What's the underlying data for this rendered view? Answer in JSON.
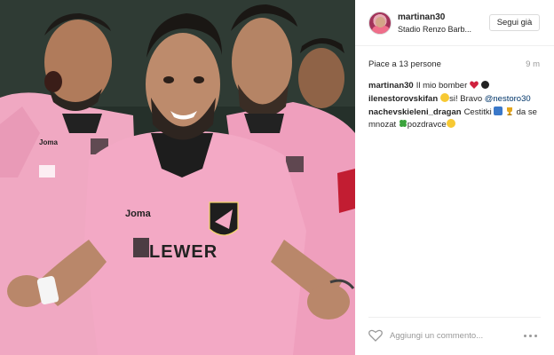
{
  "post": {
    "username": "martinan30",
    "location": "Stadio Renzo Barb...",
    "follow_label": "Segui già",
    "likes_text": "Piace a 13 persone",
    "time_ago": "9 m"
  },
  "photo": {
    "shirt_brand": "Joma",
    "sponsor": "LEWER",
    "alt_subject": "footballers in pink jerseys celebrating"
  },
  "comments": [
    {
      "user": "martinan30",
      "text": "Il mio bomber",
      "emoji": [
        "heart-icon",
        "black-circle-icon"
      ]
    },
    {
      "user": "ilenestorovskifan",
      "text_before": "",
      "text": "si! Bravo",
      "mention": "@nestoro30",
      "emoji": [
        "smiley-icon"
      ]
    },
    {
      "user": "nachevskieleni_dragan",
      "text": "Cestitki",
      "text_after": "da se mnozat",
      "text_end": "pozdravce",
      "emoji": [
        "medal-icon",
        "trophy-icon",
        "clover-icon",
        "smiley-icon"
      ]
    }
  ],
  "footer": {
    "comment_placeholder": "Aggiungi un commento..."
  },
  "colors": {
    "jersey_pink": "#f2a9c4",
    "mention_blue": "#003569",
    "heart_red": "#d0213e"
  }
}
